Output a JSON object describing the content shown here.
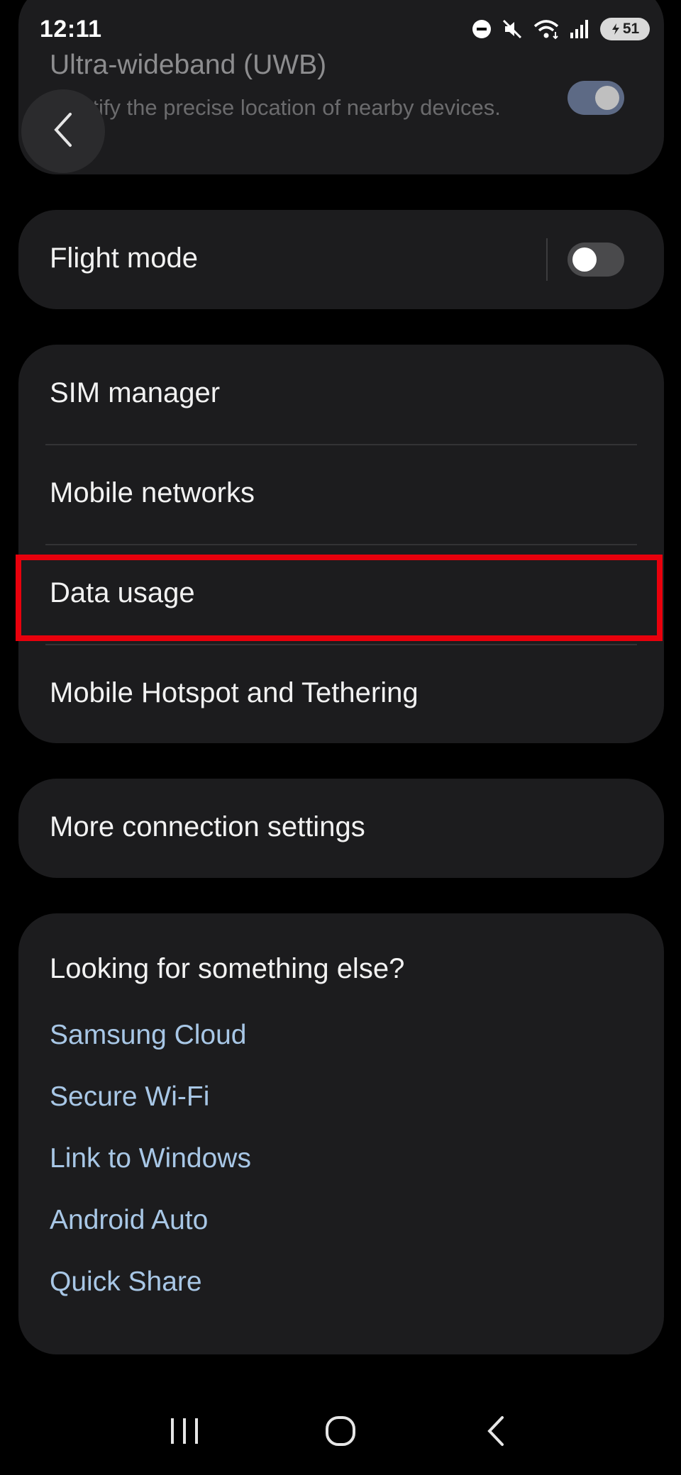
{
  "status_bar": {
    "time": "12:11",
    "battery_level": "51",
    "icons": [
      "do-not-disturb-icon",
      "mute-icon",
      "wifi-icon",
      "signal-icon",
      "battery-icon"
    ]
  },
  "uwb": {
    "title": "Ultra-wideband (UWB)",
    "description": "Identify the precise location of nearby devices.",
    "toggle_on": true
  },
  "flight_mode": {
    "label": "Flight mode",
    "toggle_on": false
  },
  "network_group": {
    "items": [
      {
        "label": "SIM manager"
      },
      {
        "label": "Mobile networks"
      },
      {
        "label": "Data usage",
        "highlighted": true
      },
      {
        "label": "Mobile Hotspot and Tethering"
      }
    ]
  },
  "more": {
    "label": "More connection settings"
  },
  "looking": {
    "title": "Looking for something else?",
    "links": [
      {
        "label": "Samsung Cloud"
      },
      {
        "label": "Secure Wi-Fi"
      },
      {
        "label": "Link to Windows"
      },
      {
        "label": "Android Auto"
      },
      {
        "label": "Quick Share"
      }
    ]
  },
  "colors": {
    "background": "#000000",
    "card": "#1c1c1e",
    "link": "#a8c7e6",
    "highlight": "#e8000c",
    "toggle_on_track": "#5d6a85"
  }
}
